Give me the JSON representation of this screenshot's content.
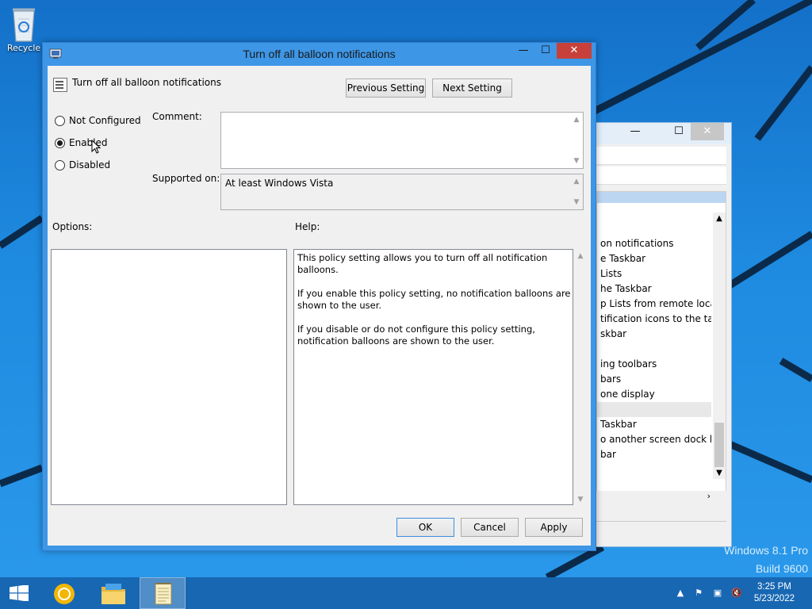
{
  "desktop": {
    "recycle_bin_label": "Recycle",
    "watermark_line1": "Windows 8.1 Pro",
    "watermark_line2": "Build 9600"
  },
  "background_window": {
    "items": [
      "on notifications",
      "e Taskbar",
      "Lists",
      "he Taskbar",
      "p Lists from remote loca...",
      "tification icons to the ta...",
      "skbar",
      "",
      "ing toolbars",
      "bars",
      "one display",
      "",
      "Taskbar",
      "o another screen dock l...",
      "bar"
    ]
  },
  "dialog": {
    "title": "Turn off all balloon notifications",
    "header_text": "Turn off all balloon notifications",
    "previous_setting_label": "Previous Setting",
    "next_setting_label": "Next Setting",
    "radio_options": [
      {
        "label": "Not Configured",
        "selected": false
      },
      {
        "label": "Enabled",
        "selected": true
      },
      {
        "label": "Disabled",
        "selected": false
      }
    ],
    "comment_label": "Comment:",
    "comment_value": "",
    "supported_on_label": "Supported on:",
    "supported_on_value": "At least Windows Vista",
    "options_label": "Options:",
    "help_label": "Help:",
    "help_paragraphs": [
      "This policy setting allows you to turn off all notification balloons.",
      "If you enable this policy setting, no notification balloons are shown to the user.",
      "If you disable or do not configure this policy setting, notification balloons are shown to the user."
    ],
    "ok_label": "OK",
    "cancel_label": "Cancel",
    "apply_label": "Apply"
  },
  "taskbar": {
    "time": "3:25 PM",
    "date": "5/23/2022"
  },
  "colors": {
    "desktop_blue": "#1e88dd",
    "window_frame": "#3d96e6",
    "close_red": "#c7413a",
    "taskbar": "#1767b3"
  },
  "icons": [
    "recycle-bin-icon",
    "gpedit-icon",
    "policy-setting-icon",
    "start-icon",
    "chrome-icon",
    "file-explorer-icon",
    "notepad-icon",
    "chevron-up-icon",
    "flag-icon",
    "network-icon",
    "speaker-muted-icon"
  ]
}
